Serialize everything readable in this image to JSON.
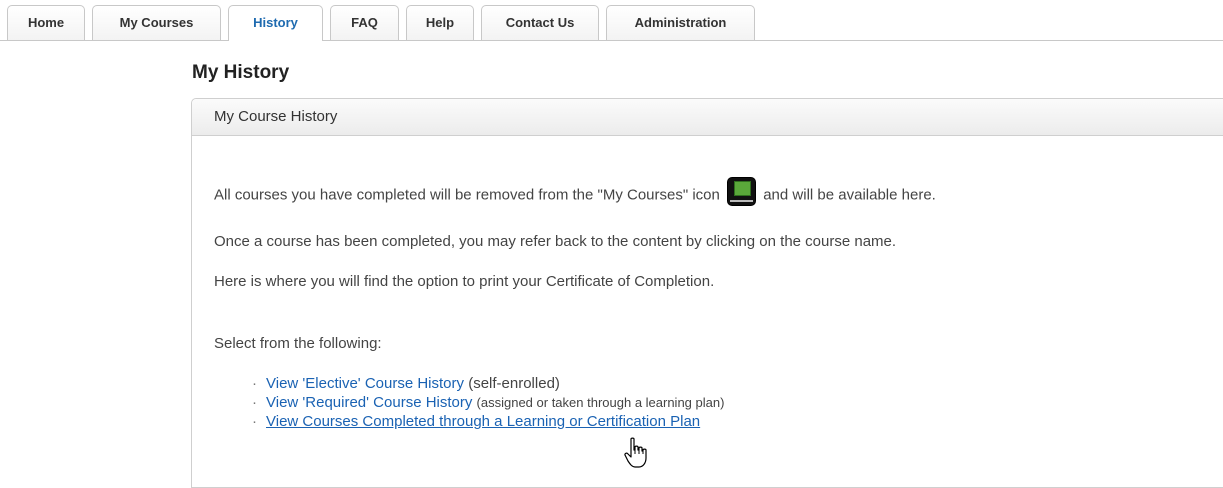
{
  "tabs": [
    {
      "label": "Home",
      "active": false
    },
    {
      "label": "My Courses",
      "active": false
    },
    {
      "label": "History",
      "active": true
    },
    {
      "label": "FAQ",
      "active": false
    },
    {
      "label": "Help",
      "active": false
    },
    {
      "label": "Contact Us",
      "active": false
    },
    {
      "label": "Administration",
      "active": false
    }
  ],
  "page": {
    "title": "My History"
  },
  "panel": {
    "header": "My Course History",
    "para1_before": "All courses you have completed will be removed from the \"My Courses\" icon",
    "para1_after": "and will be available here.",
    "para2": "Once a course has been completed, you may refer back to the content by clicking on the course name.",
    "para3": "Here is where you will find the option to print your Certificate of Completion.",
    "select_prompt": "Select from the following:",
    "links": [
      {
        "text": "View 'Elective' Course History",
        "note": "(self-enrolled)"
      },
      {
        "text": "View 'Required' Course History",
        "note": "(assigned or taken through a learning plan)"
      },
      {
        "text": "View Courses Completed through a Learning or Certification Plan",
        "note": ""
      }
    ]
  },
  "icons": {
    "my_courses_icon": "my-courses-icon",
    "cursor": "hand-pointer-cursor"
  },
  "colors": {
    "link": "#1a62b3",
    "active_tab": "#1f6bb0"
  }
}
